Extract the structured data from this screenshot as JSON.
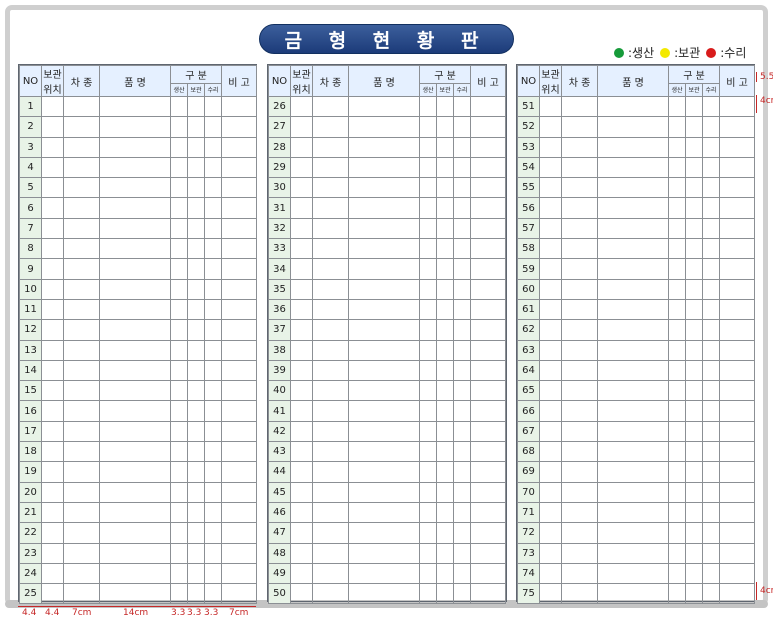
{
  "title": "금 형 현 황 판",
  "legend": [
    {
      "label": ":생산",
      "color": "#169b3a"
    },
    {
      "label": ":보관",
      "color": "#f3e900"
    },
    {
      "label": ":수리",
      "color": "#d81b1b"
    }
  ],
  "headers": {
    "no": "NO",
    "location_line1": "보관",
    "location_line2": "위치",
    "model": "차 종",
    "part_name": "품 명",
    "category": "구 분",
    "production": "생산",
    "storage": "보관",
    "repair": "수리",
    "remarks": "비 고"
  },
  "sections": [
    {
      "numbers": [
        1,
        2,
        3,
        4,
        5,
        6,
        7,
        8,
        9,
        10,
        11,
        12,
        13,
        14,
        15,
        16,
        17,
        18,
        19,
        20,
        21,
        22,
        23,
        24,
        25
      ]
    },
    {
      "numbers": [
        26,
        27,
        28,
        29,
        30,
        31,
        32,
        33,
        34,
        35,
        36,
        37,
        38,
        39,
        40,
        41,
        42,
        43,
        44,
        45,
        46,
        47,
        48,
        49,
        50
      ]
    },
    {
      "numbers": [
        51,
        52,
        53,
        54,
        55,
        56,
        57,
        58,
        59,
        60,
        61,
        62,
        63,
        64,
        65,
        66,
        67,
        68,
        69,
        70,
        71,
        72,
        73,
        74,
        75
      ]
    }
  ],
  "dimensions": {
    "right_top": "5.5",
    "right_row": "4cm",
    "right_bottom": "4cm",
    "bottom": [
      "4.4",
      "4.4",
      "7cm",
      "14cm",
      "3.3",
      "3.3",
      "3.3",
      "7cm"
    ]
  }
}
